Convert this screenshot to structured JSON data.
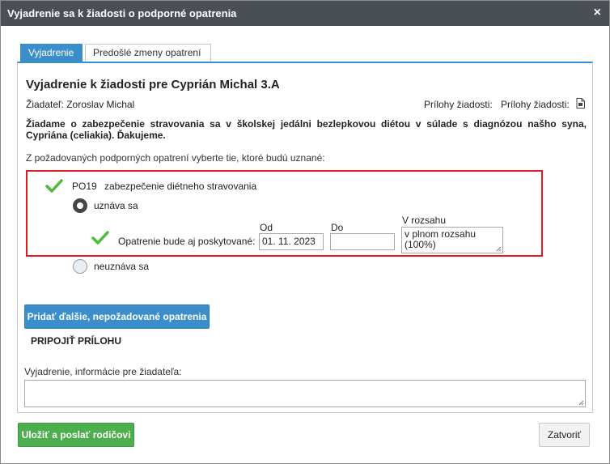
{
  "dialog": {
    "title": "Vyjadrenie sa k žiadosti o podporné opatrenia",
    "close_symbol": "×"
  },
  "tabs": [
    {
      "label": "Vyjadrenie",
      "active": true
    },
    {
      "label": "Predošlé zmeny opatrení",
      "active": false
    }
  ],
  "content": {
    "heading": "Vyjadrenie k žiadosti pre Cyprián Michal 3.A",
    "applicant": "Žiadateľ: Zoroslav Michal",
    "attachments_label": "Prílohy žiadosti:",
    "attachments_label_2": "Prílohy žiadosti:",
    "attachment_icon": "document-icon",
    "request_text": "Žiadame o zabezpečenie stravovania sa v školskej jedálni bezlepkovou diétou v súlade s diagnózou našho syna, Cypriána (celiakia). Ďakujeme.",
    "instruction": "Z požadovaných podporných opatrení vyberte tie, ktoré budú uznané:"
  },
  "measure": {
    "code": "PO19",
    "name": "zabezpečenie diétneho stravovania",
    "accept_label": "uznáva sa",
    "accepted": true,
    "provided_label": "Opatrenie bude aj poskytované:",
    "from_label": "Od",
    "from_value": "01. 11. 2023",
    "to_label": "Do",
    "to_value": "",
    "scope_label": "V rozsahu",
    "scope_value": "v plnom rozsahu (100%)",
    "reject_label": "neuznáva sa",
    "check_color": "#4cbb3a",
    "highlight_color": "#e01b24"
  },
  "actions": {
    "add_measures": "Pridať ďalšie, nepožadované opatrenia",
    "attach_file": "PRIPOJIŤ PRÍLOHU",
    "info_label": "Vyjadrenie, informácie pre žiadateľa:",
    "info_value": ""
  },
  "footer": {
    "save_send": "Uložiť a poslať rodičovi",
    "close": "Zatvoriť"
  },
  "colors": {
    "titlebar": "#4a4f55",
    "accent_blue": "#3b8ec9",
    "accent_green": "#4cae4c"
  }
}
